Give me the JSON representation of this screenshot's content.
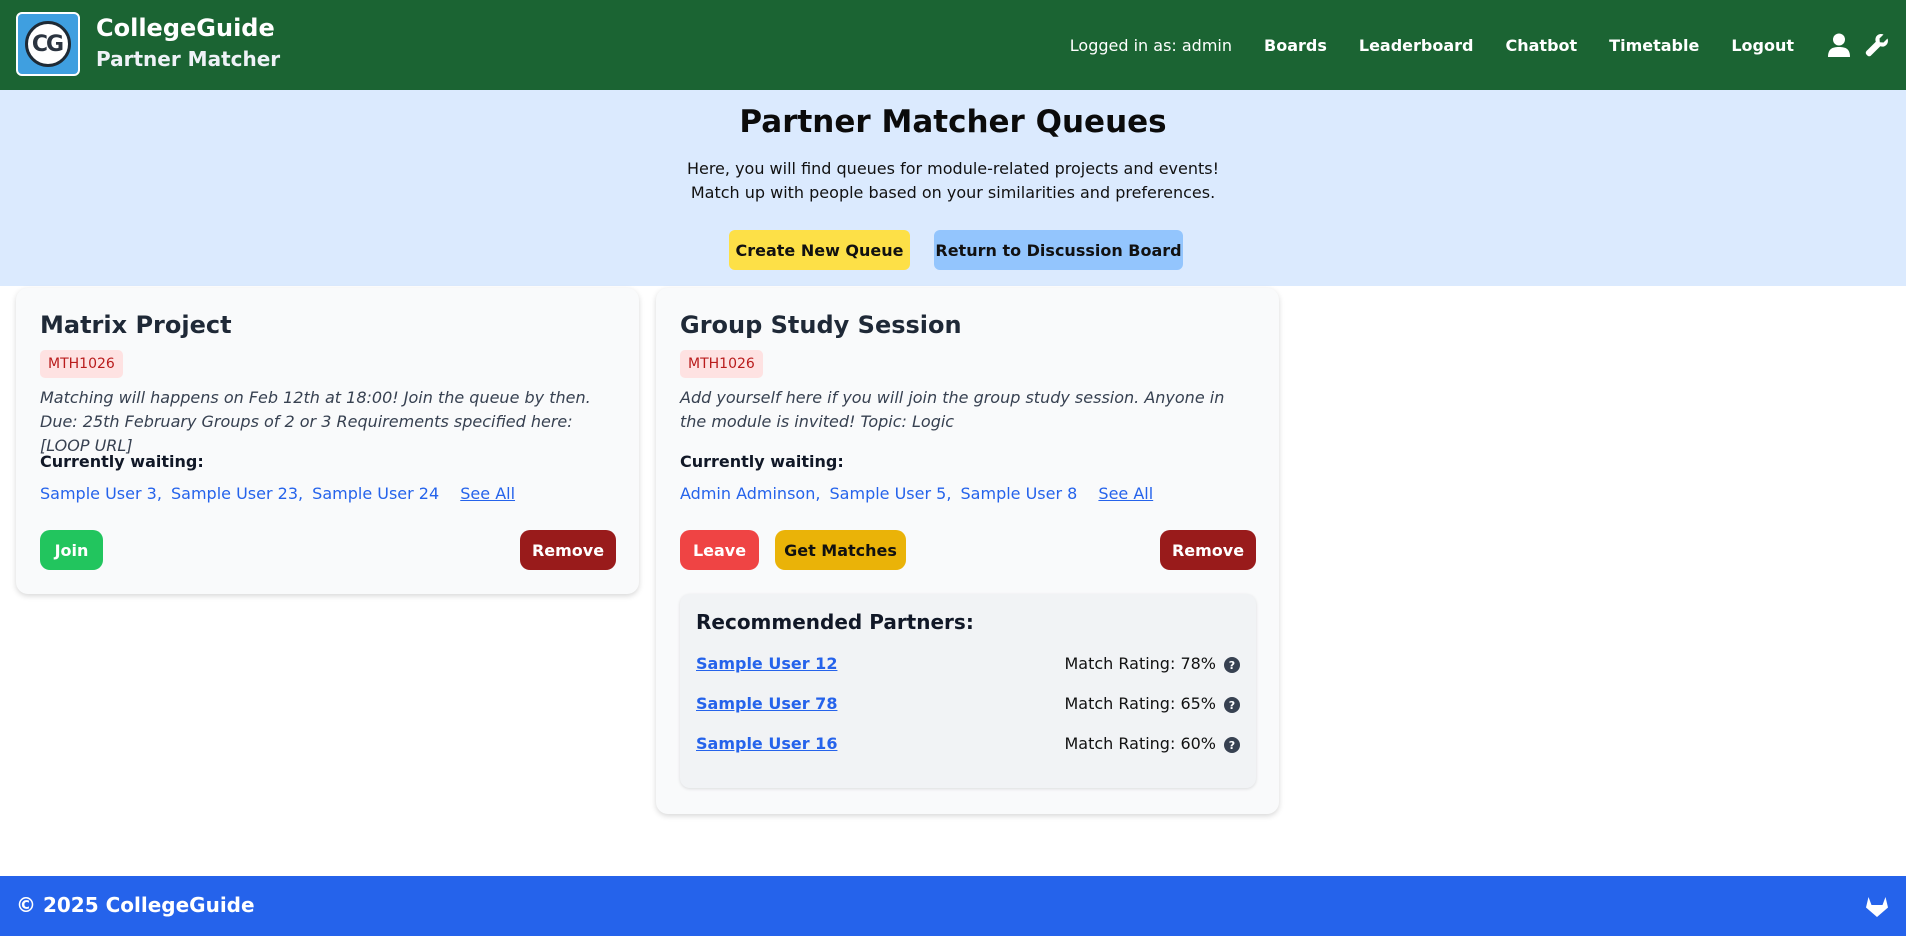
{
  "header": {
    "logo_text": "CG",
    "brand_title": "CollegeGuide",
    "brand_subtitle": "Partner Matcher",
    "login_status": "Logged in as: admin",
    "nav": [
      "Boards",
      "Leaderboard",
      "Chatbot",
      "Timetable",
      "Logout"
    ],
    "icons": [
      "user-icon",
      "wrench-icon"
    ]
  },
  "hero": {
    "title": "Partner Matcher Queues",
    "line1": "Here, you will find queues for module-related projects and events!",
    "line2": "Match up with people based on your similarities and preferences.",
    "create_label": "Create New Queue",
    "return_label": "Return to Discussion Board"
  },
  "queues": [
    {
      "title": "Matrix Project",
      "module": "MTH1026",
      "description": "Matching will happens on Feb 12th at 18:00! Join the queue by then. Due: 25th February Groups of 2 or 3 Requirements specified here: [LOOP URL]",
      "waiting_label": "Currently waiting:",
      "waiting": [
        "Sample User 3,",
        "Sample User 23,",
        "Sample User 24"
      ],
      "see_all": "See All",
      "join_label": "Join",
      "remove_label": "Remove"
    },
    {
      "title": "Group Study Session",
      "module": "MTH1026",
      "description": "Add yourself here if you will join the group study session. Anyone in the module is invited! Topic: Logic",
      "waiting_label": "Currently waiting:",
      "waiting": [
        "Admin Adminson,",
        "Sample User 5,",
        "Sample User 8"
      ],
      "see_all": "See All",
      "leave_label": "Leave",
      "matches_label": "Get Matches",
      "remove_label": "Remove",
      "recommended": {
        "title": "Recommended Partners:",
        "partners": [
          {
            "name": "Sample User 12",
            "rating": "Match Rating: 78%"
          },
          {
            "name": "Sample User 78",
            "rating": "Match Rating: 65%"
          },
          {
            "name": "Sample User 16",
            "rating": "Match Rating: 60%"
          }
        ]
      }
    }
  ],
  "footer": {
    "text": "© 2025 CollegeGuide",
    "icon": "gitlab-icon"
  },
  "colors": {
    "header_bg": "#1b6433",
    "hero_bg": "#dbeafe",
    "footer_bg": "#2563eb",
    "link": "#2563eb",
    "remove": "#991b1b",
    "join": "#22c55e",
    "leave": "#ef4444",
    "matches": "#eab308"
  }
}
